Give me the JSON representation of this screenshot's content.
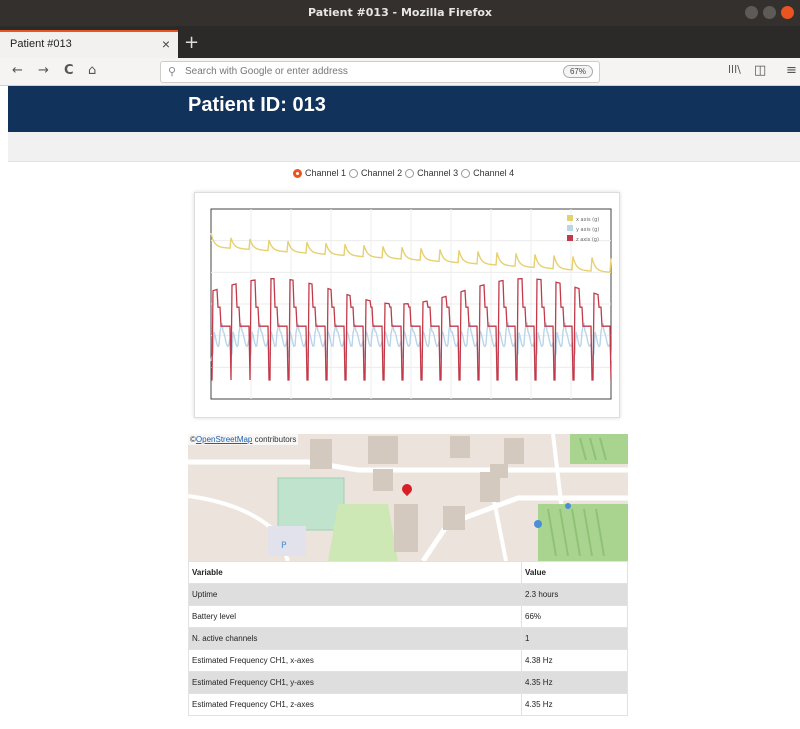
{
  "window": {
    "title": "Patient #013 - Mozilla Firefox"
  },
  "tab": {
    "label": "Patient #013",
    "close": "×",
    "new_tab": "+"
  },
  "nav": {
    "back": "←",
    "forward": "→",
    "reload": "C",
    "home": "⌂",
    "url_placeholder": "Search with Google or enter address",
    "zoom": "67%",
    "library": "lll\\",
    "sidebar": "◫",
    "menu": "≡"
  },
  "page": {
    "title": "Patient ID: 013"
  },
  "channels": {
    "options": [
      "Channel 1",
      "Channel 2",
      "Channel 3",
      "Channel 4"
    ],
    "selected": 0
  },
  "chart_data": {
    "type": "line",
    "xlim": [
      0,
      10
    ],
    "ylim": [
      -1.5,
      1.5
    ],
    "legend_position": "top-right",
    "grid": true,
    "series": [
      {
        "name": "x axis (g)",
        "color": "#e7d070"
      },
      {
        "name": "y axis (g)",
        "color": "#b9d5e9"
      },
      {
        "name": "z axis (g)",
        "color": "#c23a4a"
      }
    ]
  },
  "map": {
    "attribution_symbol": "©",
    "attribution_link": "OpenStreetMap",
    "attribution_text": " contributors"
  },
  "table": {
    "headers": [
      "Variable",
      "Value"
    ],
    "rows": [
      [
        "Uptime",
        "2.3 hours"
      ],
      [
        "Battery level",
        "66%"
      ],
      [
        "N. active channels",
        "1"
      ],
      [
        "Estimated Frequency CH1, x-axes",
        "4.38 Hz"
      ],
      [
        "Estimated Frequency CH1, y-axes",
        "4.35 Hz"
      ],
      [
        "Estimated Frequency CH1, z-axes",
        "4.35 Hz"
      ]
    ]
  }
}
